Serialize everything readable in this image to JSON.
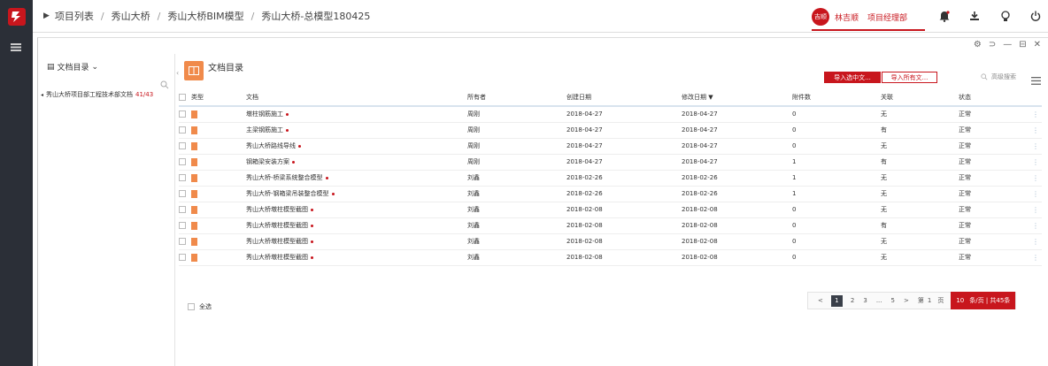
{
  "breadcrumb": [
    "项目列表",
    "秀山大桥",
    "秀山大桥BIM模型",
    "秀山大桥-总模型180425"
  ],
  "user": {
    "avatar": "吉顺",
    "name": "林吉顺",
    "dept": "项目经理部"
  },
  "icons": {
    "rail": [
      "logo-icon",
      "menu-icon"
    ],
    "topbar": [
      "bell-icon",
      "download-icon",
      "bulb-icon",
      "power-icon"
    ],
    "window": [
      "settings-icon",
      "back-icon",
      "minimize-icon",
      "maximize-icon",
      "close-icon"
    ]
  },
  "colors": {
    "accent": "#c8161d",
    "file": "#f08a4b",
    "rail": "#2b2f37"
  },
  "tree": {
    "title": "文档目录",
    "item": {
      "label": "秀山大桥项目部工程技术部文档",
      "count": "41/43"
    }
  },
  "content": {
    "title": "文档目录",
    "btn_import_selected": "导入选中文...",
    "btn_import_all": "导入所有文...",
    "adv_search": "高级搜索"
  },
  "table": {
    "headers": [
      "类型",
      "文档",
      "所有者",
      "创建日期",
      "修改日期 ▼",
      "附件数",
      "关联",
      "状态"
    ],
    "rows": [
      {
        "doc": "墩柱钢筋施工",
        "owner": "周刚",
        "created": "2018-04-27",
        "modified": "2018-04-27",
        "attach": "0",
        "rel": "无",
        "status": "正常"
      },
      {
        "doc": "主梁钢筋施工",
        "owner": "周刚",
        "created": "2018-04-27",
        "modified": "2018-04-27",
        "attach": "0",
        "rel": "有",
        "status": "正常"
      },
      {
        "doc": "秀山大桥路线导线",
        "owner": "周刚",
        "created": "2018-04-27",
        "modified": "2018-04-27",
        "attach": "0",
        "rel": "无",
        "status": "正常"
      },
      {
        "doc": "钢箱梁安装方案",
        "owner": "周刚",
        "created": "2018-04-27",
        "modified": "2018-04-27",
        "attach": "1",
        "rel": "有",
        "status": "正常"
      },
      {
        "doc": "秀山大桥-桥梁系统整合模型",
        "owner": "刘鑫",
        "created": "2018-02-26",
        "modified": "2018-02-26",
        "attach": "1",
        "rel": "无",
        "status": "正常"
      },
      {
        "doc": "秀山大桥-钢箱梁吊装整合模型",
        "owner": "刘鑫",
        "created": "2018-02-26",
        "modified": "2018-02-26",
        "attach": "1",
        "rel": "无",
        "status": "正常"
      },
      {
        "doc": "秀山大桥墩柱模型截图",
        "owner": "刘鑫",
        "created": "2018-02-08",
        "modified": "2018-02-08",
        "attach": "0",
        "rel": "无",
        "status": "正常"
      },
      {
        "doc": "秀山大桥墩柱模型截图",
        "owner": "刘鑫",
        "created": "2018-02-08",
        "modified": "2018-02-08",
        "attach": "0",
        "rel": "有",
        "status": "正常"
      },
      {
        "doc": "秀山大桥墩柱模型截图",
        "owner": "刘鑫",
        "created": "2018-02-08",
        "modified": "2018-02-08",
        "attach": "0",
        "rel": "无",
        "status": "正常"
      },
      {
        "doc": "秀山大桥墩柱模型截图",
        "owner": "刘鑫",
        "created": "2018-02-08",
        "modified": "2018-02-08",
        "attach": "0",
        "rel": "无",
        "status": "正常"
      }
    ],
    "select_all": "全选"
  },
  "pager": {
    "prev": "<",
    "pages": [
      "1",
      "2",
      "3",
      "...",
      "5"
    ],
    "next": ">",
    "goto_a": "第",
    "goto_page": "1",
    "goto_b": "页",
    "per_page": "10",
    "summary": "条/页 | 共45条"
  }
}
